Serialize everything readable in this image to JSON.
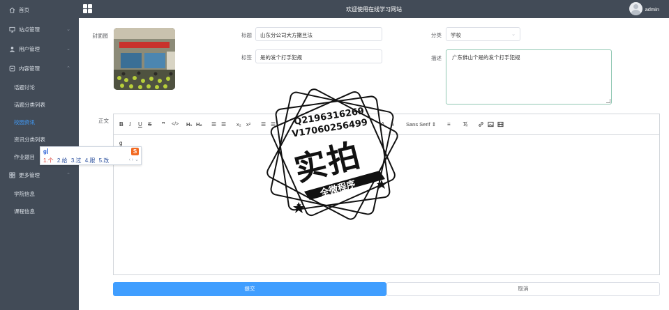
{
  "header": {
    "title": "欢迎使用在线学习网站",
    "user": "admin"
  },
  "sidebar": {
    "items": [
      {
        "label": "首页",
        "icon": "home-icon",
        "chevron": false
      },
      {
        "label": "站点管理",
        "icon": "desktop-icon",
        "chevron": true
      },
      {
        "label": "用户管理",
        "icon": "user-icon",
        "chevron": true
      },
      {
        "label": "内容管理",
        "icon": "content-icon",
        "chevron": true,
        "expanded": true
      },
      {
        "label": "更多管理",
        "icon": "more-icon",
        "chevron": true
      }
    ],
    "sub_content": [
      "话题讨论",
      "话题分类列表",
      "校园资讯",
      "资讯分类列表",
      "作业题目"
    ],
    "sub_more": [
      "学院信息",
      "课程信息"
    ],
    "active": "校园资讯"
  },
  "form": {
    "cover_label": "封面图",
    "title_label": "标题",
    "title_value": "山东分公司大方撒旦法",
    "category_label": "分类",
    "category_value": "学校",
    "tag_label": "标签",
    "tag_value": "是的发个打手犯规",
    "desc_label": "描述",
    "desc_value": "广东佛山个是的发个打手犯规",
    "content_label": "正文"
  },
  "editor": {
    "typed": "g",
    "font_family": "Sans Serif",
    "ime": {
      "input": "g",
      "candidates": [
        "1.个",
        "2.给",
        "3.过",
        "4.跟",
        "5.改"
      ],
      "logo": "S"
    }
  },
  "actions": {
    "submit": "提交",
    "cancel": "取消"
  },
  "watermark": {
    "line1": "Q2196316269",
    "line2": "V17060256499",
    "big": "实拍",
    "ribbon": "全微程序"
  },
  "colors": {
    "sidebar_bg": "#424b57",
    "accent": "#409eff"
  }
}
